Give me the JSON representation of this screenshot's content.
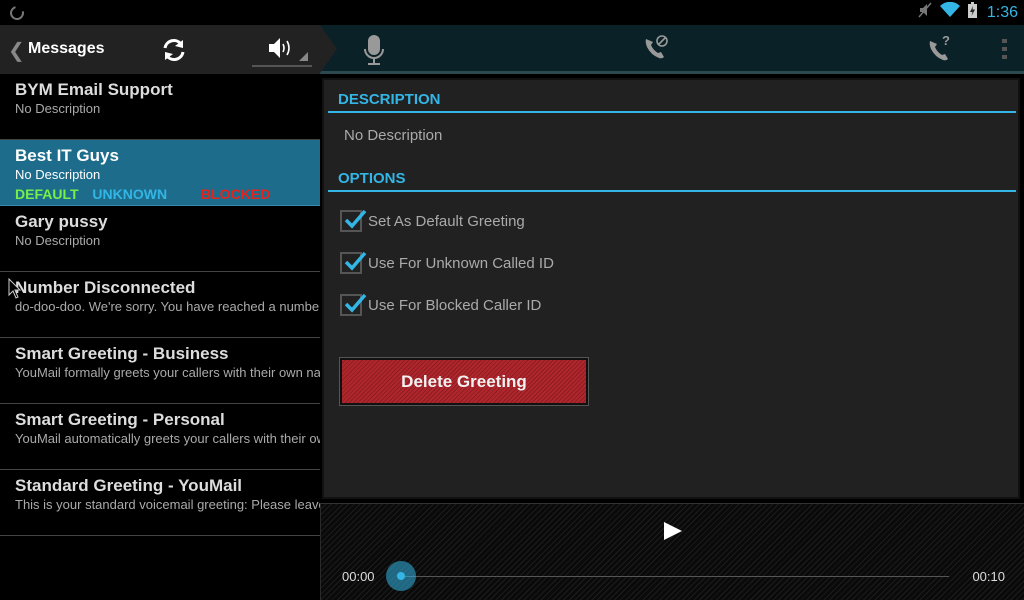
{
  "status_bar": {
    "time": "1:36",
    "icons": [
      "loading-spinner-icon",
      "mute-icon",
      "wifi-icon",
      "battery-charging-icon"
    ]
  },
  "action_bar": {
    "back_icon": "chevron-left-icon",
    "title": "Messages",
    "refresh_icon": "refresh-icon",
    "speaker_icon": "speaker-icon",
    "actions": [
      {
        "name": "record-greeting",
        "icon": "microphone-icon"
      },
      {
        "name": "blocked-caller",
        "icon": "phone-blocked-icon"
      },
      {
        "name": "unknown-caller",
        "icon": "phone-question-icon"
      },
      {
        "name": "overflow-menu",
        "icon": "overflow-menu-icon"
      }
    ]
  },
  "greetings": [
    {
      "name": "BYM Email Support",
      "description": "No Description",
      "selected": false
    },
    {
      "name": "Best IT Guys",
      "description": "No Description",
      "selected": true,
      "tags": {
        "default": "DEFAULT",
        "unknown": "UNKNOWN",
        "blocked": "BLOCKED"
      }
    },
    {
      "name": "Gary pussy",
      "description": "No Description",
      "selected": false
    },
    {
      "name": "Number Disconnected",
      "description": "do-doo-doo.   We're sorry. You have reached a number that has been disconnected",
      "selected": false
    },
    {
      "name": "Smart Greeting - Business",
      "description": "YouMail formally greets your callers with their own name",
      "selected": false
    },
    {
      "name": "Smart Greeting - Personal",
      "description": "YouMail automatically greets your callers with their own name",
      "selected": false
    },
    {
      "name": "Standard Greeting - YouMail",
      "description": "This is your standard voicemail greeting: Please leave a message",
      "selected": false
    }
  ],
  "detail": {
    "description_header": "DESCRIPTION",
    "description_text": "No Description",
    "options_header": "OPTIONS",
    "options": [
      {
        "label": "Set As Default Greeting",
        "checked": true
      },
      {
        "label": "Use For Unknown Called ID",
        "checked": true
      },
      {
        "label": "Use For Blocked Caller ID",
        "checked": true
      }
    ],
    "delete_label": "Delete Greeting"
  },
  "player": {
    "current_time": "00:00",
    "duration": "00:10",
    "progress": 0,
    "play_icon": "play-icon"
  },
  "colors": {
    "accent": "#33b5e5",
    "selected_row": "#1e6c8b",
    "tag_default": "#74f04a",
    "tag_unknown": "#33b5e5",
    "tag_blocked": "#e3241f",
    "delete_button": "#b0262d"
  }
}
